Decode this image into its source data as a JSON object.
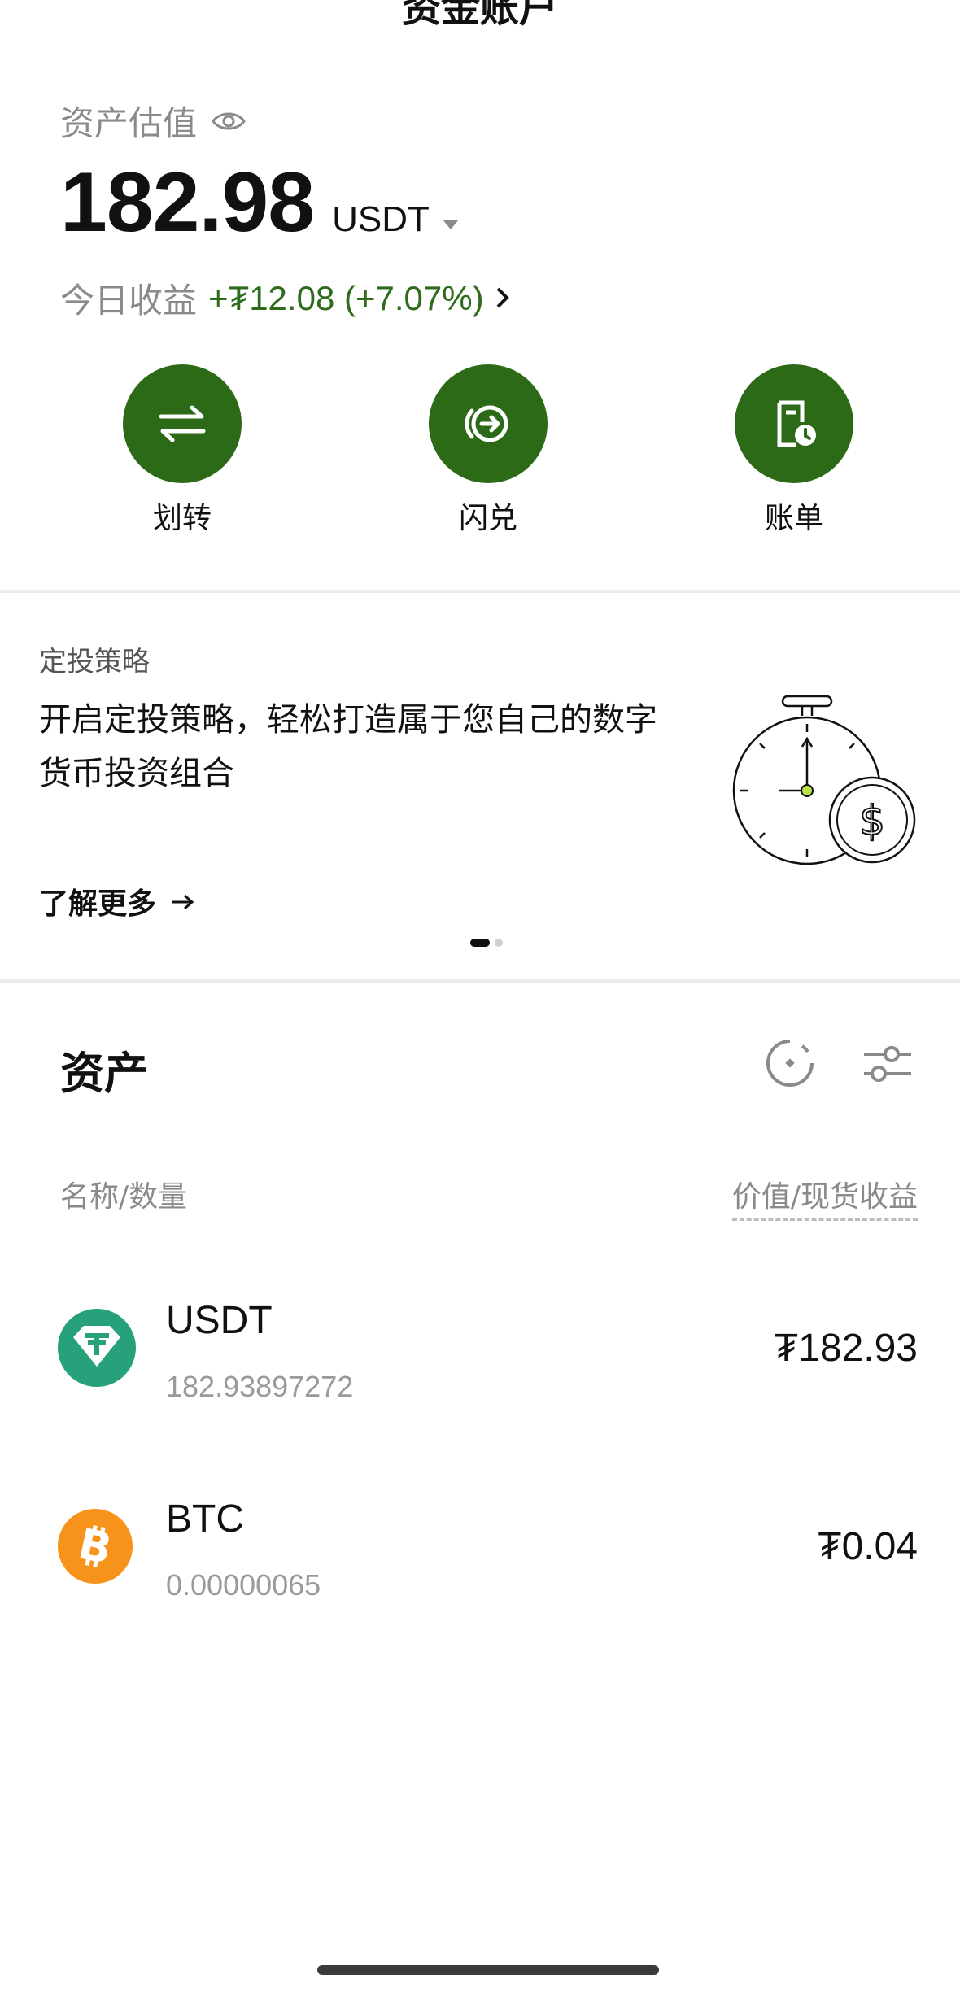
{
  "header": {
    "title": "资金账户"
  },
  "summary": {
    "label": "资产估值",
    "balance": "182.98",
    "currency": "USDT",
    "pnl_label": "今日收益",
    "pnl_value": "+₮12.08 (+7.07%)"
  },
  "actions": [
    {
      "label": "划转",
      "icon": "transfer-icon"
    },
    {
      "label": "闪兑",
      "icon": "convert-icon"
    },
    {
      "label": "账单",
      "icon": "bill-icon"
    }
  ],
  "banner": {
    "category": "定投策略",
    "text": "开启定投策略，轻松打造属于您自己的数字货币投资组合",
    "link": "了解更多"
  },
  "assets": {
    "title": "资产",
    "col_left": "名称/数量",
    "col_right": "价值/现货收益",
    "items": [
      {
        "symbol": "USDT",
        "quantity": "182.93897272",
        "value": "₮182.93",
        "color": "#26a17b"
      },
      {
        "symbol": "BTC",
        "quantity": "0.00000065",
        "value": "₮0.04",
        "color": "#f7931a"
      }
    ]
  },
  "colors": {
    "accent": "#2d6a18",
    "pnl": "#2e6b1b"
  }
}
